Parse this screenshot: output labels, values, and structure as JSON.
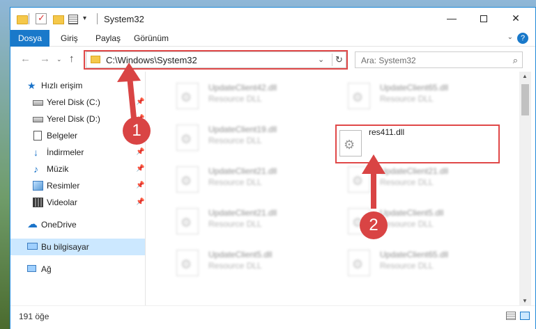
{
  "window": {
    "title": "System32",
    "minimize": "—",
    "close": "✕"
  },
  "quick_access": {
    "dropdown": "▾"
  },
  "ribbon": {
    "tabs": [
      "Dosya",
      "Giriş",
      "Paylaş",
      "Görünüm"
    ],
    "help": "?",
    "collapse": "⌄"
  },
  "navigation": {
    "back": "←",
    "forward": "→",
    "recent": "⌄",
    "up": "↑",
    "address": "C:\\Windows\\System32",
    "address_dropdown": "⌄",
    "refresh": "↻",
    "search_placeholder": "Ara: System32",
    "search_icon": "⌕"
  },
  "sidebar": {
    "pin_glyph": "📌",
    "items": [
      {
        "label": "Hızlı erişim",
        "icon": "star-icon"
      },
      {
        "label": "Yerel Disk (C:)",
        "icon": "drive-icon",
        "pinned": true
      },
      {
        "label": "Yerel Disk (D:)",
        "icon": "drive-icon",
        "pinned": true
      },
      {
        "label": "Belgeler",
        "icon": "documents-icon",
        "pinned": true
      },
      {
        "label": "İndirmeler",
        "icon": "download-icon",
        "pinned": true
      },
      {
        "label": "Müzik",
        "icon": "music-icon",
        "pinned": true
      },
      {
        "label": "Resimler",
        "icon": "pictures-icon",
        "pinned": true
      },
      {
        "label": "Videolar",
        "icon": "video-icon",
        "pinned": true
      },
      {
        "label": "OneDrive",
        "icon": "onedrive-icon"
      },
      {
        "label": "Bu bilgisayar",
        "icon": "computer-icon",
        "selected": true
      },
      {
        "label": "Ağ",
        "icon": "network-icon"
      }
    ]
  },
  "files": {
    "left_column": [
      {
        "name": "UpdateClient42.dll",
        "type": "Resource DLL"
      },
      {
        "name": "UpdateClient19.dll",
        "type": "Resource DLL"
      },
      {
        "name": "UpdateClient21.dll",
        "type": "Resource DLL"
      },
      {
        "name": "UpdateClient21.dll",
        "type": "Resource DLL"
      },
      {
        "name": "UpdateClient5.dll",
        "type": "Resource DLL"
      }
    ],
    "right_column": [
      {
        "name": "UpdateClient65.dll",
        "type": "Resource DLL"
      },
      {
        "name": "res411.dll",
        "type": "",
        "highlighted": true
      },
      {
        "name": "UpdateClient21.dll",
        "type": "Resource DLL"
      },
      {
        "name": "UpdateClient5.dll",
        "type": "Resource DLL"
      },
      {
        "name": "UpdateClient65.dll",
        "type": "Resource DLL"
      }
    ]
  },
  "status": {
    "item_count": "191 öğe"
  },
  "annotations": {
    "badge_1": "1",
    "badge_2": "2",
    "color": "#d94444"
  },
  "colors": {
    "accent": "#1979ca",
    "highlight_border": "#e04848",
    "selection": "#cce8ff"
  }
}
